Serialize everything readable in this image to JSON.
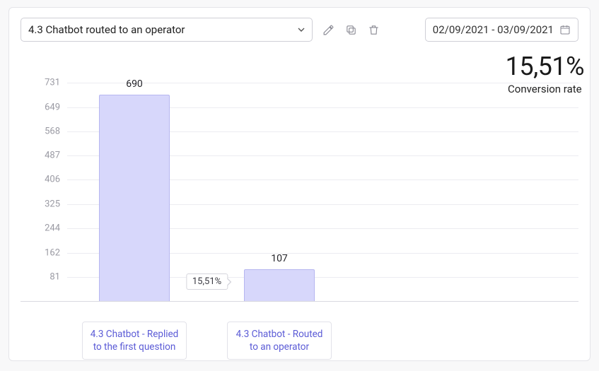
{
  "toolbar": {
    "select_value": "4.3 Chatbot routed to an operator",
    "date_range": "02/09/2021 - 03/09/2021"
  },
  "kpi": {
    "value": "15,51%",
    "label": "Conversion rate"
  },
  "funnel": {
    "step_conversion_label": "15,51%"
  },
  "chart_data": {
    "type": "bar",
    "title": "",
    "xlabel": "",
    "ylabel": "",
    "ylim": [
      0,
      731
    ],
    "y_ticks": [
      81,
      162,
      244,
      325,
      406,
      487,
      568,
      649,
      731
    ],
    "categories": [
      "4.3 Chatbot - Replied to the first question",
      "4.3 Chatbot - Routed to an operator"
    ],
    "values": [
      690,
      107
    ],
    "series_color": "#d7d7fb",
    "annotations": [
      {
        "between": [
          0,
          1
        ],
        "text": "15,51%"
      }
    ]
  }
}
